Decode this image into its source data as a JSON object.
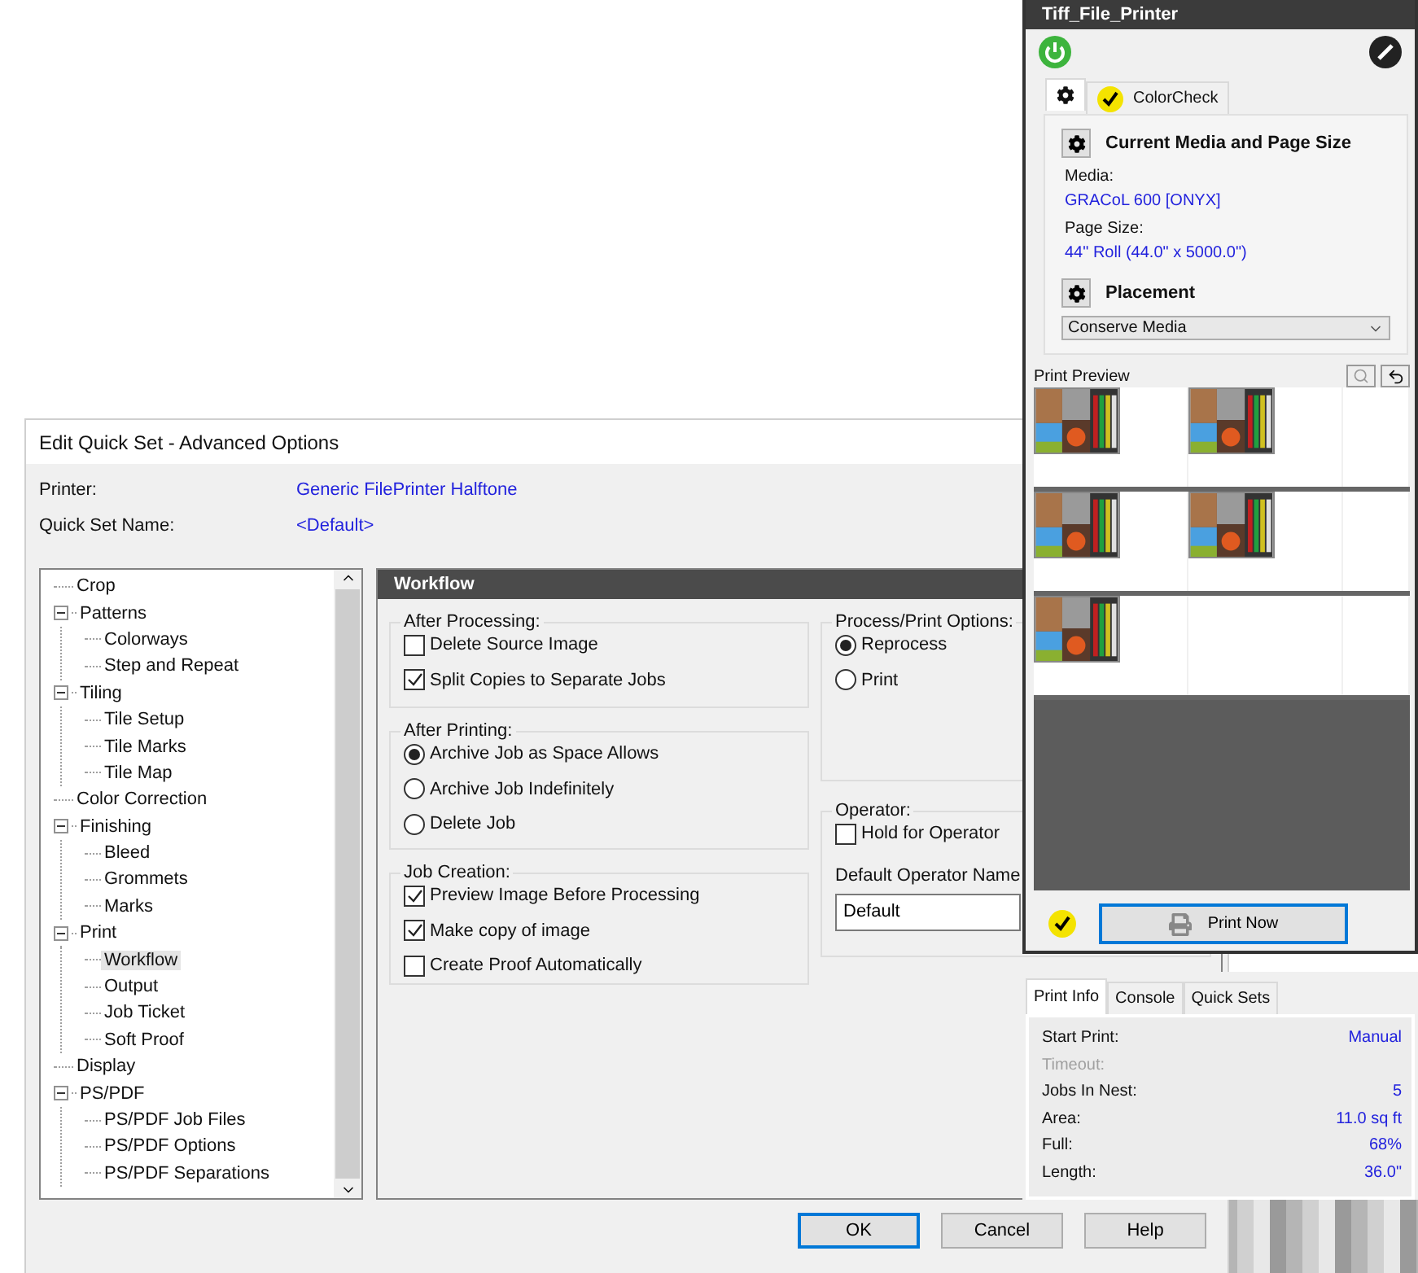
{
  "dialog": {
    "title": "Edit Quick Set - Advanced Options",
    "fields": [
      {
        "label": "Printer:",
        "value": "Generic FilePrinter Halftone"
      },
      {
        "label": "Quick Set Name:",
        "value": "<Default>"
      }
    ],
    "tree": [
      {
        "label": "Crop",
        "selected": false
      },
      {
        "label": "Patterns",
        "selected": false,
        "expanded": true,
        "children": [
          {
            "label": "Colorways",
            "selected": false
          },
          {
            "label": "Step and Repeat",
            "selected": false
          }
        ]
      },
      {
        "label": "Tiling",
        "selected": false,
        "expanded": true,
        "children": [
          {
            "label": "Tile Setup",
            "selected": false
          },
          {
            "label": "Tile Marks",
            "selected": false
          },
          {
            "label": "Tile Map",
            "selected": false
          }
        ]
      },
      {
        "label": "Color Correction",
        "selected": false
      },
      {
        "label": "Finishing",
        "selected": false,
        "expanded": true,
        "children": [
          {
            "label": "Bleed",
            "selected": false
          },
          {
            "label": "Grommets",
            "selected": false
          },
          {
            "label": "Marks",
            "selected": false
          }
        ]
      },
      {
        "label": "Print",
        "selected": false,
        "expanded": true,
        "children": [
          {
            "label": "Workflow",
            "selected": true
          },
          {
            "label": "Output",
            "selected": false
          },
          {
            "label": "Job Ticket",
            "selected": false
          },
          {
            "label": "Soft Proof",
            "selected": false
          }
        ]
      },
      {
        "label": "Display",
        "selected": false
      },
      {
        "label": "PS/PDF",
        "selected": false,
        "expanded": true,
        "children": [
          {
            "label": "PS/PDF Job Files",
            "selected": false
          },
          {
            "label": "PS/PDF Options",
            "selected": false
          },
          {
            "label": "PS/PDF Separations",
            "selected": false
          }
        ]
      }
    ],
    "section": {
      "title": "Workflow",
      "left_groups": [
        {
          "title": "After Processing:",
          "options": [
            {
              "kind": "checkbox",
              "label": "Delete Source Image",
              "checked": false
            },
            {
              "kind": "checkbox",
              "label": "Split Copies to Separate Jobs",
              "checked": true
            }
          ]
        },
        {
          "title": "After Printing:",
          "options": [
            {
              "kind": "radio",
              "label": "Archive Job as Space Allows",
              "selected": true
            },
            {
              "kind": "radio",
              "label": "Archive Job Indefinitely",
              "selected": false
            },
            {
              "kind": "radio",
              "label": "Delete Job",
              "selected": false
            }
          ]
        },
        {
          "title": "Job Creation:",
          "options": [
            {
              "kind": "checkbox",
              "label": "Preview Image Before Processing",
              "checked": true
            },
            {
              "kind": "checkbox",
              "label": "Make copy of image",
              "checked": true
            },
            {
              "kind": "checkbox",
              "label": "Create Proof Automatically",
              "checked": false
            }
          ]
        }
      ],
      "right_groups": [
        {
          "title": "Process/Print Options:",
          "options": [
            {
              "kind": "radio",
              "label": "Reprocess",
              "selected": true
            },
            {
              "kind": "radio",
              "label": "Print",
              "selected": false
            }
          ]
        },
        {
          "title": "Operator:",
          "options": [
            {
              "kind": "checkbox",
              "label": "Hold for Operator",
              "checked": false
            },
            {
              "kind": "field",
              "label": "Default Operator Name",
              "value": "Default"
            }
          ]
        }
      ]
    },
    "buttons": [
      {
        "label": "OK",
        "default": true
      },
      {
        "label": "Cancel",
        "default": false
      },
      {
        "label": "Help",
        "default": false
      }
    ]
  },
  "printer_panel": {
    "title": "Tiff_File_Printer",
    "tabs": [
      {
        "kind": "settings",
        "selected": true
      },
      {
        "kind": "colorcheck",
        "label": "ColorCheck",
        "selected": false
      }
    ],
    "media": {
      "heading": "Current Media and Page Size",
      "details": [
        {
          "label": "Media:",
          "value": "GRACoL 600 [ONYX]"
        },
        {
          "label": "Page Size:",
          "value": "44\" Roll (44.0\" x 5000.0\")"
        }
      ]
    },
    "placement": {
      "heading": "Placement",
      "value": "Conserve Media"
    },
    "preview": {
      "title": "Print Preview"
    },
    "print_button": "Print Now"
  },
  "info_panel": {
    "tabs": [
      {
        "label": "Print Info",
        "selected": true
      },
      {
        "label": "Console",
        "selected": false
      },
      {
        "label": "Quick Sets",
        "selected": false
      }
    ],
    "rows": [
      {
        "label": "Start Print:",
        "value": "Manual",
        "disabled": false
      },
      {
        "label": "Timeout:",
        "disabled": true
      },
      {
        "label": "Jobs In Nest:",
        "value": "5",
        "disabled": false
      },
      {
        "label": "Area:",
        "value": "11.0 sq ft",
        "disabled": false
      },
      {
        "label": "Full:",
        "value": "68%",
        "disabled": false
      },
      {
        "label": "Length:",
        "value": "36.0\"",
        "disabled": false
      }
    ]
  }
}
